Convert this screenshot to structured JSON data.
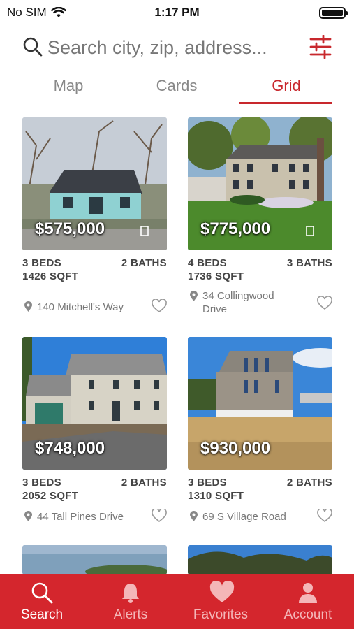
{
  "status_bar": {
    "carrier": "No SIM",
    "time": "1:17 PM",
    "battery_level": 1.0
  },
  "search": {
    "placeholder": "Search city, zip, address...",
    "value": ""
  },
  "tabs": [
    {
      "label": "Map",
      "active": false
    },
    {
      "label": "Cards",
      "active": false
    },
    {
      "label": "Grid",
      "active": true
    }
  ],
  "listings": [
    {
      "price": "$575,000",
      "beds": "3 BEDS",
      "baths": "2 BATHS",
      "sqft": "1426 SQFT",
      "address": "140 Mitchell's Way",
      "has_doc_icon": true
    },
    {
      "price": "$775,000",
      "beds": "4 BEDS",
      "baths": "3 BATHS",
      "sqft": "1736 SQFT",
      "address": "34 Collingwood Drive",
      "has_doc_icon": true
    },
    {
      "price": "$748,000",
      "beds": "3 BEDS",
      "baths": "2 BATHS",
      "sqft": "2052 SQFT",
      "address": "44 Tall Pines Drive",
      "has_doc_icon": false
    },
    {
      "price": "$930,000",
      "beds": "3 BEDS",
      "baths": "2 BATHS",
      "sqft": "1310 SQFT",
      "address": "69 S Village Road",
      "has_doc_icon": false
    }
  ],
  "bottom_nav": [
    {
      "label": "Search",
      "icon": "search-icon",
      "active": true
    },
    {
      "label": "Alerts",
      "icon": "bell-icon",
      "active": false
    },
    {
      "label": "Favorites",
      "icon": "heart-icon",
      "active": false
    },
    {
      "label": "Account",
      "icon": "person-icon",
      "active": false
    }
  ],
  "colors": {
    "accent": "#c8282d",
    "nav_background": "#d4262d"
  }
}
